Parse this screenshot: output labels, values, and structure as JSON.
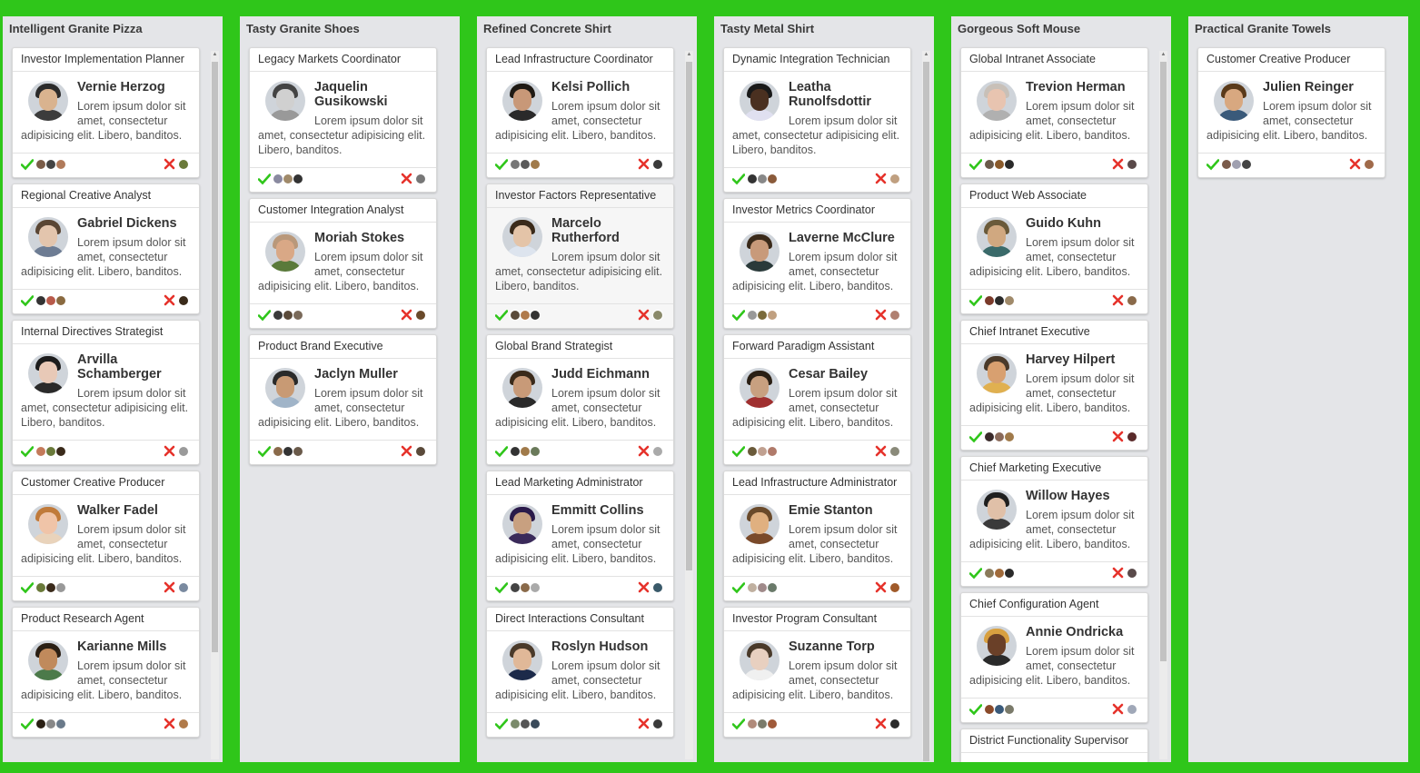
{
  "lorem": "Lorem ipsum dolor sit amet, consectetur adipisicing elit. Libero, banditos.",
  "colors": {
    "board_bg": "#2fc61a",
    "column_bg": "#e4e5e8",
    "check": "#2fc61a",
    "cross": "#e6322b"
  },
  "columns": [
    {
      "title": "Intelligent Granite Pizza",
      "cards": [
        {
          "title": "Investor Implementation Planner",
          "name": "Vernie Herzog",
          "skin": "#d9b38f",
          "hair": "#2b2b2b",
          "shirt": "#3c3c3c",
          "minis_left": [
            "#7a5c48",
            "#444",
            "#b07a5a"
          ],
          "minis_right": [
            "#6a7a3a"
          ]
        },
        {
          "title": "Regional Creative Analyst",
          "name": "Gabriel Dickens",
          "skin": "#e3c5ad",
          "hair": "#5a4634",
          "shirt": "#6d7c93",
          "minis_left": [
            "#333",
            "#b85a4a",
            "#8a6a40"
          ],
          "minis_right": [
            "#3a2a1a"
          ]
        },
        {
          "title": "Internal Directives Strategist",
          "name": "Arvilla Schamberger",
          "skin": "#e8c9b7",
          "hair": "#1c1c1c",
          "shirt": "#2a2a2a",
          "minis_left": [
            "#c47a5a",
            "#6a7a3a",
            "#3a2a1a"
          ],
          "minis_right": [
            "#9a9a9a"
          ]
        },
        {
          "title": "Customer Creative Producer",
          "name": "Walker Fadel",
          "skin": "#f0c4a8",
          "hair": "#c07a3a",
          "shirt": "#e9d3bb",
          "minis_left": [
            "#6a7a3a",
            "#3a2a1a",
            "#999"
          ],
          "minis_right": [
            "#7a8aa0"
          ]
        },
        {
          "title": "Product Research Agent",
          "name": "Karianne Mills",
          "skin": "#c08a5c",
          "hair": "#2a1f14",
          "shirt": "#4c7a4a",
          "minis_left": [
            "#2a1f14",
            "#888",
            "#6a7a8a"
          ],
          "minis_right": [
            "#b07a4a"
          ]
        }
      ]
    },
    {
      "title": "Tasty Granite Shoes",
      "cards": [
        {
          "title": "Legacy Markets Coordinator",
          "name": "Jaquelin Gusikowski",
          "skin": "#d0d0d0",
          "hair": "#444",
          "shirt": "#999",
          "minis_left": [
            "#8a8aa0",
            "#a08a6a",
            "#333"
          ],
          "minis_right": [
            "#777"
          ]
        },
        {
          "title": "Customer Integration Analyst",
          "name": "Moriah Stokes",
          "skin": "#d9a886",
          "hair": "#b9987a",
          "shirt": "#5a7a3a",
          "minis_left": [
            "#3a3a3a",
            "#5a4a3a",
            "#7a6a5a"
          ],
          "minis_right": [
            "#6a4a2a"
          ]
        },
        {
          "title": "Product Brand Executive",
          "name": "Jaclyn Muller",
          "skin": "#c89a74",
          "hair": "#2a2a2a",
          "shirt": "#a0b4c8",
          "minis_left": [
            "#8a6a4a",
            "#333",
            "#6a5a4a"
          ],
          "minis_right": [
            "#5a4a3a"
          ]
        }
      ]
    },
    {
      "title": "Refined Concrete Shirt",
      "cards": [
        {
          "title": "Lead Infrastructure Coordinator",
          "name": "Kelsi Pollich",
          "skin": "#c89878",
          "hair": "#1f1a14",
          "shirt": "#2a2a2a",
          "minis_left": [
            "#777",
            "#5a5a5a",
            "#a07a4a"
          ],
          "minis_right": [
            "#3a3a3a"
          ]
        },
        {
          "title": "Investor Factors Representative",
          "name": "Marcelo Rutherford",
          "skin": "#e4c4a8",
          "hair": "#3a2a1a",
          "shirt": "#dde4ee",
          "highlight": true,
          "minis_left": [
            "#5a4a3a",
            "#b07a4a",
            "#333"
          ],
          "minis_right": [
            "#8a8a6a"
          ]
        },
        {
          "title": "Global Brand Strategist",
          "name": "Judd Eichmann",
          "skin": "#c89a78",
          "hair": "#3a2a1a",
          "shirt": "#2a2a2a",
          "minis_left": [
            "#333",
            "#a07a4a",
            "#6a7a5a"
          ],
          "minis_right": [
            "#aaa"
          ]
        },
        {
          "title": "Lead Marketing Administrator",
          "name": "Emmitt Collins",
          "skin": "#c8a080",
          "hair": "#2a1a4a",
          "shirt": "#3a2a5a",
          "minis_left": [
            "#444",
            "#8a6a4a",
            "#aaa"
          ],
          "minis_right": [
            "#3a5a6a"
          ]
        },
        {
          "title": "Direct Interactions Consultant",
          "name": "Roslyn Hudson",
          "skin": "#e0b898",
          "hair": "#4a3a2a",
          "shirt": "#1c2a4a",
          "minis_left": [
            "#7a8a6a",
            "#555",
            "#3a4a5a"
          ],
          "minis_right": [
            "#3a3a3a"
          ]
        }
      ]
    },
    {
      "title": "Tasty Metal Shirt",
      "cards": [
        {
          "title": "Dynamic Integration Technician",
          "name": "Leatha Runolfsdottir",
          "skin": "#4a3020",
          "hair": "#1a1a1a",
          "shirt": "#e0e0f0",
          "minis_left": [
            "#333",
            "#888",
            "#8a5a3a"
          ],
          "minis_right": [
            "#c0a080"
          ]
        },
        {
          "title": "Investor Metrics Coordinator",
          "name": "Laverne McClure",
          "skin": "#c89a7a",
          "hair": "#3a2a1a",
          "shirt": "#2a3a3a",
          "minis_left": [
            "#999",
            "#7a6a3a",
            "#c0a080"
          ],
          "minis_right": [
            "#b08070"
          ]
        },
        {
          "title": "Forward Paradigm Assistant",
          "name": "Cesar Bailey",
          "skin": "#c8a080",
          "hair": "#2a1f14",
          "shirt": "#a03030",
          "minis_left": [
            "#6a5a3a",
            "#c0a090",
            "#b07a6a"
          ],
          "minis_right": [
            "#8a8a7a"
          ]
        },
        {
          "title": "Lead Infrastructure Administrator",
          "name": "Emie Stanton",
          "skin": "#e0b080",
          "hair": "#6a4a2a",
          "shirt": "#7a4a2a",
          "minis_left": [
            "#c0b0a0",
            "#a08a8a",
            "#6a7a6a"
          ],
          "minis_right": [
            "#a05a2a"
          ]
        },
        {
          "title": "Investor Program Consultant",
          "name": "Suzanne Torp",
          "skin": "#e8d0c0",
          "hair": "#4a3a2a",
          "shirt": "#f0f0f0",
          "minis_left": [
            "#b08a7a",
            "#7a7a6a",
            "#a05a3a"
          ],
          "minis_right": [
            "#2a2a2a"
          ]
        }
      ]
    },
    {
      "title": "Gorgeous Soft Mouse",
      "cards": [
        {
          "title": "Global Intranet Associate",
          "name": "Trevion Herman",
          "skin": "#e8c4b0",
          "hair": "#c8c0b8",
          "shirt": "#b0b0b0",
          "minis_left": [
            "#6a5a4a",
            "#8a5a2a",
            "#2a2a2a"
          ],
          "minis_right": [
            "#5a4a4a"
          ]
        },
        {
          "title": "Product Web Associate",
          "name": "Guido Kuhn",
          "skin": "#d0a880",
          "hair": "#6a5a3a",
          "shirt": "#3a6a6a",
          "minis_left": [
            "#7a3a2a",
            "#2a2a2a",
            "#a08a6a"
          ],
          "minis_right": [
            "#8a6a4a"
          ]
        },
        {
          "title": "Chief Intranet Executive",
          "name": "Harvey Hilpert",
          "skin": "#d8a070",
          "hair": "#4a3a2a",
          "shirt": "#e0b050",
          "minis_left": [
            "#3a2a2a",
            "#8a6a5a",
            "#a07a4a"
          ],
          "minis_right": [
            "#5a2a2a"
          ]
        },
        {
          "title": "Chief Marketing Executive",
          "name": "Willow Hayes",
          "skin": "#e0c0a8",
          "hair": "#1f1f1f",
          "shirt": "#3a3a3a",
          "minis_left": [
            "#8a7a5a",
            "#a06a3a",
            "#2a2a2a"
          ],
          "minis_right": [
            "#5a4a4a"
          ]
        },
        {
          "title": "Chief Configuration Agent",
          "name": "Annie Ondricka",
          "skin": "#6a4028",
          "hair": "#d8a040",
          "shirt": "#2a2a2a",
          "minis_left": [
            "#8a4a2a",
            "#3a5a7a",
            "#7a7a6a"
          ],
          "minis_right": [
            "#a0a8b8"
          ]
        },
        {
          "title": "District Functionality Supervisor",
          "name": "",
          "skin": "#d0a080",
          "hair": "#3a2a1a",
          "shirt": "#555",
          "minis_left": [],
          "minis_right": []
        }
      ]
    },
    {
      "title": "Practical Granite Towels",
      "cards": [
        {
          "title": "Customer Creative Producer",
          "name": "Julien Reinger",
          "skin": "#d8a880",
          "hair": "#5a3a1a",
          "shirt": "#3a5a7a",
          "minis_left": [
            "#7a5a4a",
            "#a0a0b0",
            "#444"
          ],
          "minis_right": [
            "#a06a4a"
          ]
        }
      ]
    }
  ]
}
